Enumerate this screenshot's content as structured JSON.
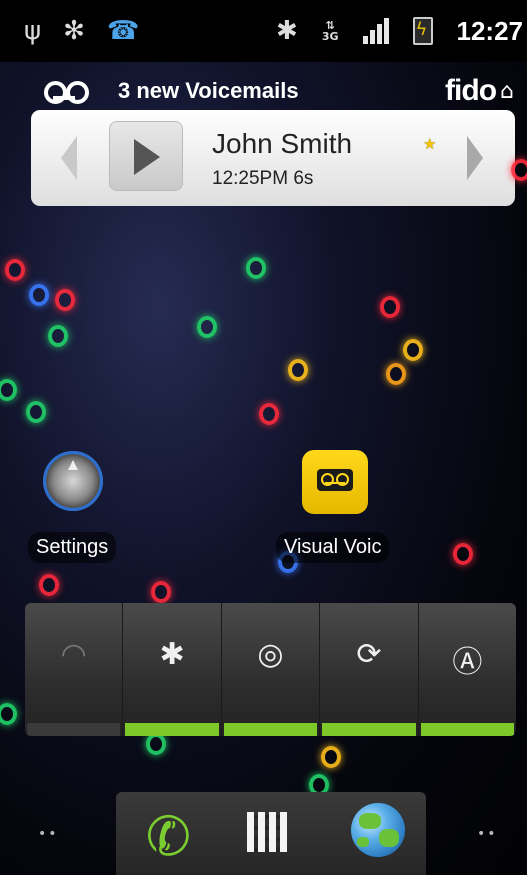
{
  "status_bar": {
    "time": "12:27",
    "network_type": "3G",
    "icons": [
      "usb-icon",
      "android-debug-icon",
      "call-forward-icon",
      "bluetooth-icon",
      "data-3g-icon",
      "signal-icon",
      "battery-charging-icon"
    ]
  },
  "voicemail_widget": {
    "count_text": "3 new Voicemails",
    "carrier": "fido",
    "caller_name": "John Smith",
    "meta": "12:25PM 6s"
  },
  "home_apps": [
    {
      "label": "Settings",
      "icon": "settings-icon"
    },
    {
      "label": "Visual Voic",
      "icon": "visual-voicemail-icon"
    }
  ],
  "power_control": {
    "toggles": [
      {
        "name": "wifi",
        "glyph": "◠",
        "state": "off"
      },
      {
        "name": "bluetooth",
        "glyph": "✱",
        "state": "on"
      },
      {
        "name": "gps",
        "glyph": "◎",
        "state": "on"
      },
      {
        "name": "sync",
        "glyph": "⟳",
        "state": "on"
      },
      {
        "name": "brightness",
        "glyph": "Ⓐ",
        "state": "on"
      }
    ],
    "colors": {
      "on": "#7ec82a",
      "off": "#3a3a3a"
    }
  },
  "dock": {
    "items": [
      "phone-icon",
      "app-drawer-icon",
      "browser-icon"
    ]
  },
  "page_indicator": {
    "left": "••",
    "right": "••"
  }
}
